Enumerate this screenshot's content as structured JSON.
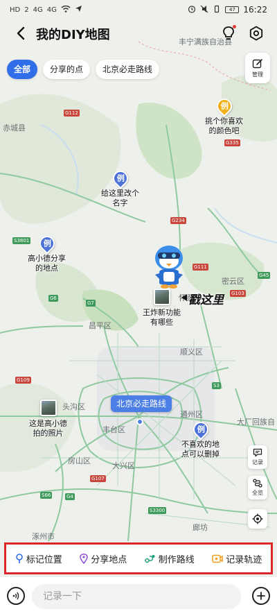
{
  "status_bar": {
    "left_indicators": [
      "HD",
      "2",
      "4G",
      "4G"
    ],
    "battery": "47",
    "time": "16:22"
  },
  "header": {
    "title": "我的DIY地图",
    "back_icon": "chevron-left-icon",
    "idea_icon": "lightbulb-icon",
    "settings_icon": "settings-icon"
  },
  "filter_tabs": [
    {
      "label": "全部",
      "active": true
    },
    {
      "label": "分享的点",
      "active": false
    },
    {
      "label": "北京必走路线",
      "active": false
    }
  ],
  "manage": {
    "label": "管理",
    "icon": "edit-icon"
  },
  "map": {
    "place_labels": [
      "丰宁满族自治县",
      "赤城县",
      "昌平区",
      "顺义区",
      "密云区",
      "头沟区",
      "丰台区",
      "通州区",
      "大厂回族自",
      "房山区",
      "大兴区",
      "涿州市",
      "廊坊"
    ],
    "road_badges": [
      "G112",
      "G335",
      "G234",
      "G111",
      "S3801",
      "G6",
      "G7",
      "G45",
      "G103",
      "G109",
      "S3",
      "G4",
      "G107",
      "S3300",
      "S66"
    ],
    "slogan": "戳这里",
    "partial_label": "怀柔"
  },
  "pins": [
    {
      "marker": "例",
      "color": "yellow",
      "lines": [
        "挑个你喜欢",
        "的颜色吧"
      ]
    },
    {
      "marker": "例",
      "color": "blue",
      "lines": [
        "给这里改个",
        "名字"
      ]
    },
    {
      "marker": "例",
      "color": "blue",
      "lines": [
        "高小德分享",
        "的地点"
      ]
    },
    {
      "marker": "例",
      "color": "blue",
      "lines": [
        "不喜欢的地",
        "点可以删掉"
      ]
    }
  ],
  "photo_pins": [
    {
      "lines": [
        "王炸新功能",
        "有哪些"
      ]
    },
    {
      "lines": [
        "这是高小德",
        "拍的照片"
      ]
    }
  ],
  "route_label": "北京必走路线",
  "side_buttons": [
    {
      "label": "记录",
      "icon": "note-icon"
    },
    {
      "label": "全览",
      "icon": "route-overview-icon"
    },
    {
      "label": "",
      "icon": "locate-icon"
    }
  ],
  "actions": [
    {
      "label": "标记位置",
      "icon": "pin-icon",
      "color": "#2f6ee8"
    },
    {
      "label": "分享地点",
      "icon": "location-icon",
      "color": "#8a4fd6"
    },
    {
      "label": "制作路线",
      "icon": "route-icon",
      "color": "#1aa07a"
    },
    {
      "label": "记录轨迹",
      "icon": "track-icon",
      "color": "#f0a01a"
    }
  ],
  "bottom": {
    "placeholder": "记录一下",
    "voice_icon": "voice-icon",
    "add_icon": "plus-icon"
  },
  "colors": {
    "accent": "#2f6ee8",
    "highlight_border": "#d9272a",
    "pin_blue": "#4d73d9",
    "pin_yellow": "#f0b21a"
  }
}
